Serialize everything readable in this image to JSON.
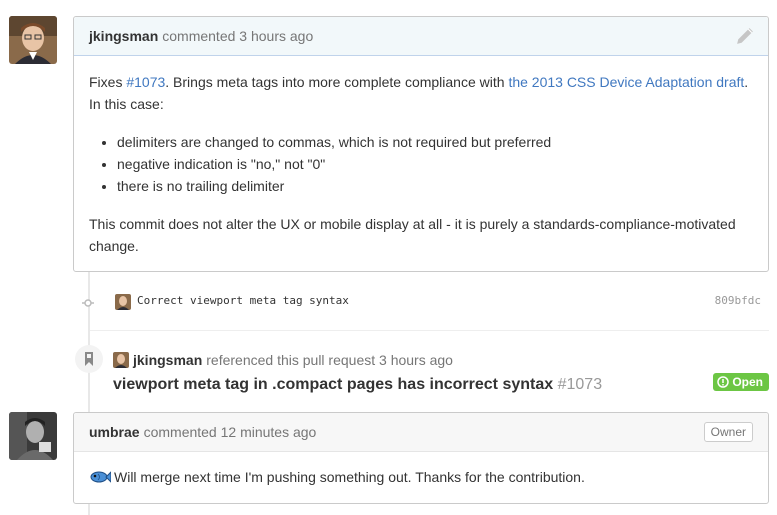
{
  "comment1": {
    "author": "jkingsman",
    "meta": "commented 3 hours ago",
    "intro_prefix": "Fixes ",
    "issue_link": "#1073",
    "intro_middle": ". Brings meta tags into more complete compliance with ",
    "draft_link": "the 2013 CSS Device Adaptation draft",
    "intro_suffix": ". In this case:",
    "bullets": [
      "delimiters are changed to commas, which is not required but preferred",
      "negative indication is \"no,\" not \"0\"",
      "there is no trailing delimiter"
    ],
    "closing": "This commit does not alter the UX or mobile display at all - it is purely a standards-compliance-motivated change."
  },
  "commit": {
    "message": "Correct viewport meta tag syntax",
    "sha": "809bfdc"
  },
  "reference": {
    "author": "jkingsman",
    "text": "referenced this pull request 3 hours ago",
    "title": "viewport meta tag in .compact pages has incorrect syntax",
    "number": "#1073",
    "state": "Open"
  },
  "comment2": {
    "author": "umbrae",
    "meta": "commented 12 minutes ago",
    "badge": "Owner",
    "body": "Will merge next time I'm pushing something out. Thanks for the contribution."
  },
  "colors": {
    "link": "#4078c0",
    "open_green": "#6cc644"
  }
}
